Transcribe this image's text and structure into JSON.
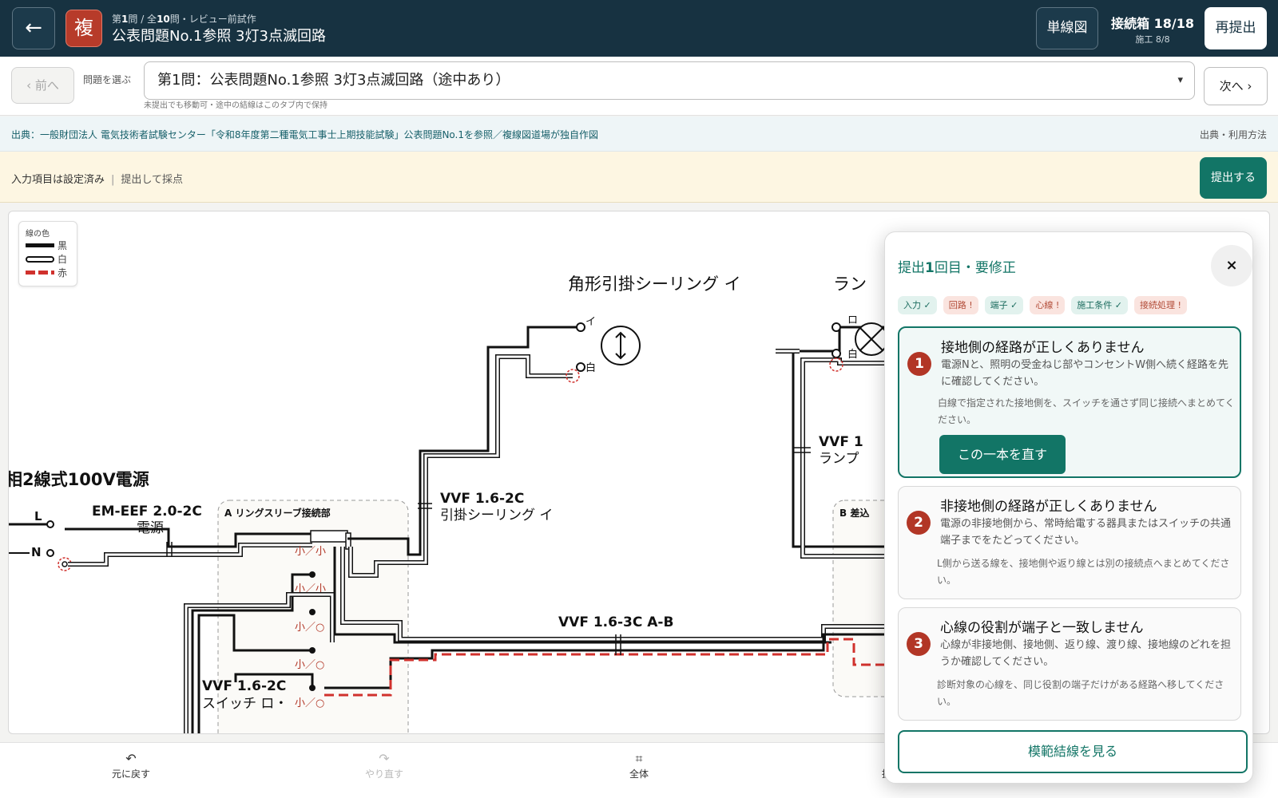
{
  "topbar": {
    "back_icon": "←",
    "mode_badge": "複",
    "crumb_prefix": "第",
    "crumb_num": "1",
    "crumb_mid": "問 / 全",
    "crumb_total": "10",
    "crumb_suffix": "問・レビュー前試作",
    "title": "公表問題No.1参照 3灯3点滅回路",
    "diagram_button": "単線図",
    "connection_label": "接続箱 18/18",
    "construction_label": "施工 8/8",
    "resubmit_button": "再提出"
  },
  "selector": {
    "prev_button": "‹ 前へ",
    "label": "問題を選ぶ",
    "selected": "第1問：公表問題No.1参照 3灯3点滅回路（途中あり）",
    "hint": "未提出でも移動可・途中の結線はこのタブ内で保持",
    "next_button": "次へ ›"
  },
  "source": {
    "text": "出典：一般財団法人 電気技術者試験センター「令和8年度第二種電気工事士上期技能試験」公表問題No.1を参照／複線図道場が独自作図",
    "link": "出典・利用方法"
  },
  "status": {
    "main": "入力項目は設定済み",
    "separator": "|",
    "sub": "提出して採点",
    "submit_button": "提出する"
  },
  "legend": {
    "title": "線の色",
    "items": [
      {
        "label": "黒",
        "color": "#111111"
      },
      {
        "label": "白",
        "color": "#ffffff"
      },
      {
        "label": "赤",
        "color": "#d0312d"
      }
    ]
  },
  "diagram": {
    "title_ceiling": "角形引掛シーリング イ",
    "title_lamp": "ラン",
    "source_label": "相2線式100V電源",
    "term_L": "L",
    "term_N": "N",
    "cable_source": "EM-EEF 2.0-2C",
    "cable_source_sub": "電源",
    "box_a": "A リングスリーブ接続部",
    "box_b": "B 差込",
    "sleeve_labels": [
      "小／小",
      "小／小",
      "小／○",
      "小／○",
      "小／○"
    ],
    "cable_ceiling": "VVF 1.6-2C",
    "cable_ceiling_sub": "引掛シーリング イ",
    "cable_ab": "VVF 1.6-3C A-B",
    "cable_switch": "VVF 1.6-2C",
    "cable_switch_sub": "スイッチ ロ・",
    "cable_lamp": "VVF 1",
    "cable_lamp_sub": "ランプ",
    "term_i": "イ",
    "term_white": "白",
    "term_ro": "ロ",
    "term_white2": "白",
    "colors": {
      "black": "#111111",
      "red": "#d0312d",
      "white_outline": "#111111"
    }
  },
  "panel": {
    "title_prefix": "提出",
    "title_num": "1",
    "title_suffix": "回目・要修正",
    "close_icon": "×",
    "chips": [
      {
        "label": "入力 ✓",
        "state": "ok"
      },
      {
        "label": "回路 !",
        "state": "ng"
      },
      {
        "label": "端子 ✓",
        "state": "ok"
      },
      {
        "label": "心線 !",
        "state": "ng"
      },
      {
        "label": "施工条件 ✓",
        "state": "ok"
      },
      {
        "label": "接続処理 !",
        "state": "ng"
      }
    ],
    "issues": [
      {
        "num": "1",
        "heading": "接地側の経路が正しくありません",
        "description": "電源Nと、照明の受金ねじ部やコンセントW側へ続く経路を先に確認してください。",
        "hint": "白線で指定された接地側を、スイッチを通さず同じ接続へまとめてください。",
        "fix_button": "この一本を直す"
      },
      {
        "num": "2",
        "heading": "非接地側の経路が正しくありません",
        "description": "電源の非接地側から、常時給電する器具またはスイッチの共通端子までをたどってください。",
        "hint": "L側から送る線を、接地側や返り線とは別の接続点へまとめてください。"
      },
      {
        "num": "3",
        "heading": "心線の役割が端子と一致しません",
        "description": "心線が非接地側、接地側、返り線、渡り線、接地線のどれを担うか確認してください。",
        "hint": "診断対象の心線を、同じ役割の端子だけがある経路へ移してください。"
      }
    ],
    "model_button": "模範結線を見る"
  },
  "toolbar": {
    "undo_icon": "↶",
    "undo_label": "元に戻す",
    "redo_icon": "↷",
    "redo_label": "やり直す",
    "fit_icon": "⌗",
    "fit_label": "全体",
    "zoom_label": "拡"
  },
  "accent": "#127566",
  "error_color": "#b23626",
  "header_bg": "#173241"
}
